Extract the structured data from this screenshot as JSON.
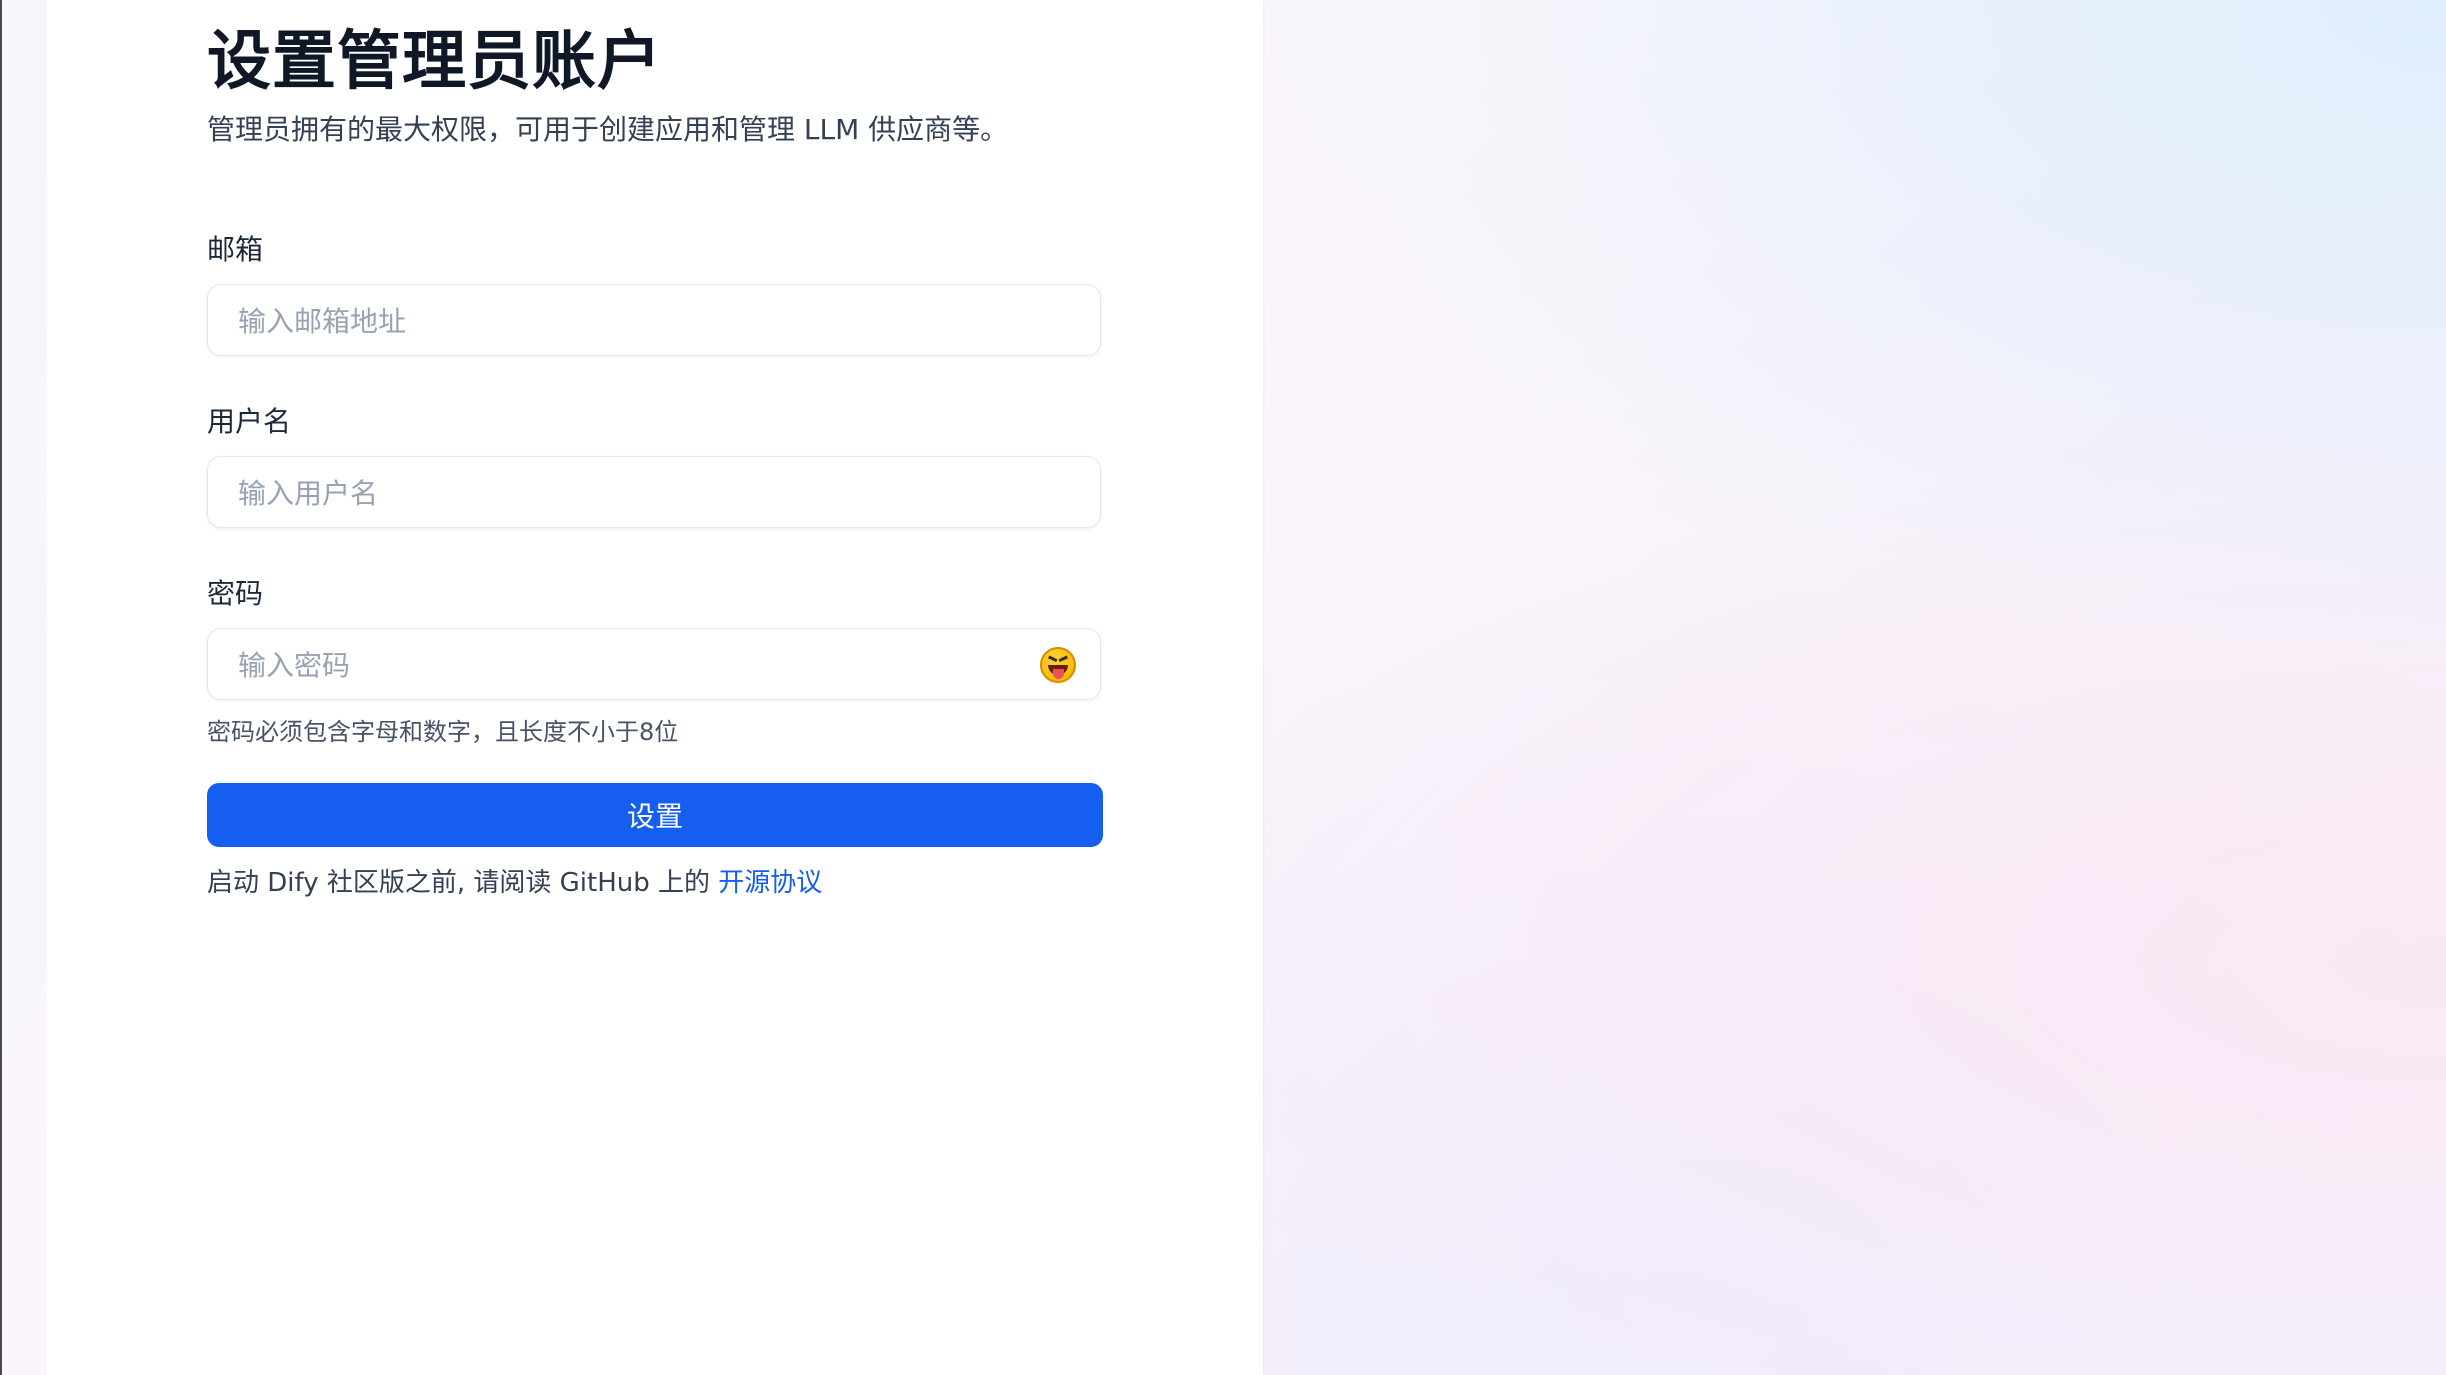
{
  "form": {
    "title": "设置管理员账户",
    "subtitle": "管理员拥有的最大权限，可用于创建应用和管理 LLM 供应商等。",
    "email": {
      "label": "邮箱",
      "placeholder": "输入邮箱地址",
      "value": ""
    },
    "username": {
      "label": "用户名",
      "placeholder": "输入用户名",
      "value": ""
    },
    "password": {
      "label": "密码",
      "placeholder": "输入密码",
      "value": "",
      "toggle_icon": "winking-tongue-face-icon"
    },
    "password_hint": "密码必须包含字母和数字，且长度不小于8位",
    "submit_label": "设置",
    "footer_text": "启动 Dify 社区版之前, 请阅读 GitHub 上的 ",
    "footer_link": "开源协议"
  },
  "colors": {
    "primary": "#155eef",
    "title": "#101828",
    "text": "#344054",
    "placeholder": "#98a2b3"
  }
}
